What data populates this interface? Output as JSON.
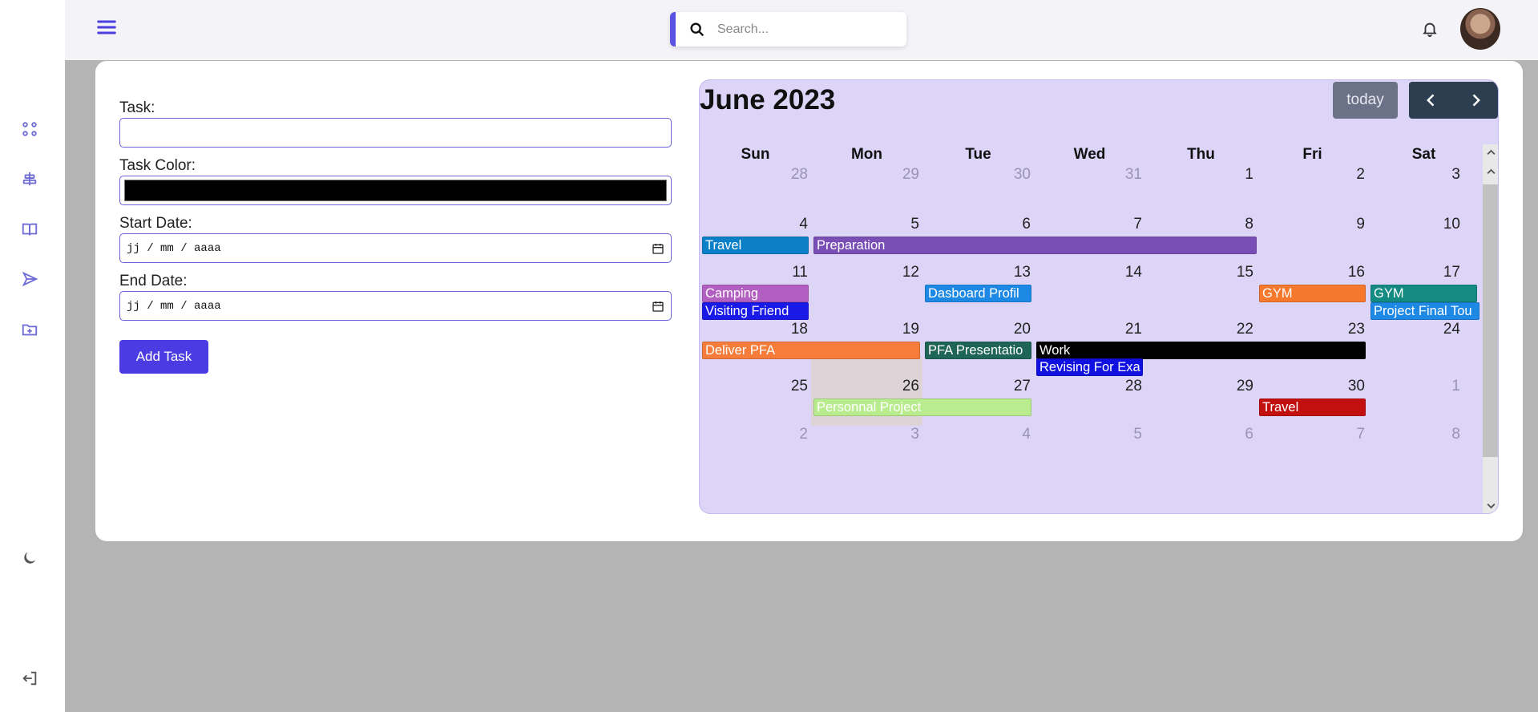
{
  "sidebar": {
    "icons": [
      "dashboard-icon",
      "tasks-icon",
      "book-icon",
      "send-icon",
      "folder-add-icon",
      "moon-icon",
      "logout-icon"
    ]
  },
  "header": {
    "search_placeholder": "Search..."
  },
  "form": {
    "task_label": "Task:",
    "task_value": "",
    "color_label": "Task Color:",
    "color_value": "#000000",
    "start_label": "Start Date:",
    "start_value": "jj / mm / aaaa",
    "end_label": "End Date:",
    "end_value": "jj / mm / aaaa",
    "add_button": "Add Task"
  },
  "calendar": {
    "title": "June 2023",
    "today_button": "today",
    "weekdays": [
      "Sun",
      "Mon",
      "Tue",
      "Wed",
      "Thu",
      "Fri",
      "Sat"
    ],
    "weeks": [
      [
        "28",
        "29",
        "30",
        "31",
        "1",
        "2",
        "3"
      ],
      [
        "4",
        "5",
        "6",
        "7",
        "8",
        "9",
        "10"
      ],
      [
        "11",
        "12",
        "13",
        "14",
        "15",
        "16",
        "17"
      ],
      [
        "18",
        "19",
        "20",
        "21",
        "22",
        "23",
        "24"
      ],
      [
        "25",
        "26",
        "27",
        "28",
        "29",
        "30",
        "1"
      ],
      [
        "2",
        "3",
        "4",
        "5",
        "6",
        "7",
        "8"
      ]
    ],
    "events": [
      {
        "title": "Travel",
        "color": "#0b7fc7"
      },
      {
        "title": "Preparation",
        "color": "#7a4fb5"
      },
      {
        "title": "Camping",
        "color": "#b35fc2"
      },
      {
        "title": "Visiting Friend",
        "color": "#1a1ae8"
      },
      {
        "title": "Dasboard Profil",
        "color": "#1e88e5"
      },
      {
        "title": "GYM",
        "color": "#f5782d"
      },
      {
        "title": "GYM",
        "color": "#138a82"
      },
      {
        "title": "Project Final Tou",
        "color": "#1e88e5"
      },
      {
        "title": "Deliver PFA",
        "color": "#f57c3a"
      },
      {
        "title": "PFA Presentatio",
        "color": "#1e6457"
      },
      {
        "title": "Work",
        "color": "#000000"
      },
      {
        "title": "Revising For Exa",
        "color": "#1010e0"
      },
      {
        "title": "Personnal Project",
        "color": "#b8ec8e"
      },
      {
        "title": "Travel",
        "color": "#c2100f"
      }
    ]
  }
}
